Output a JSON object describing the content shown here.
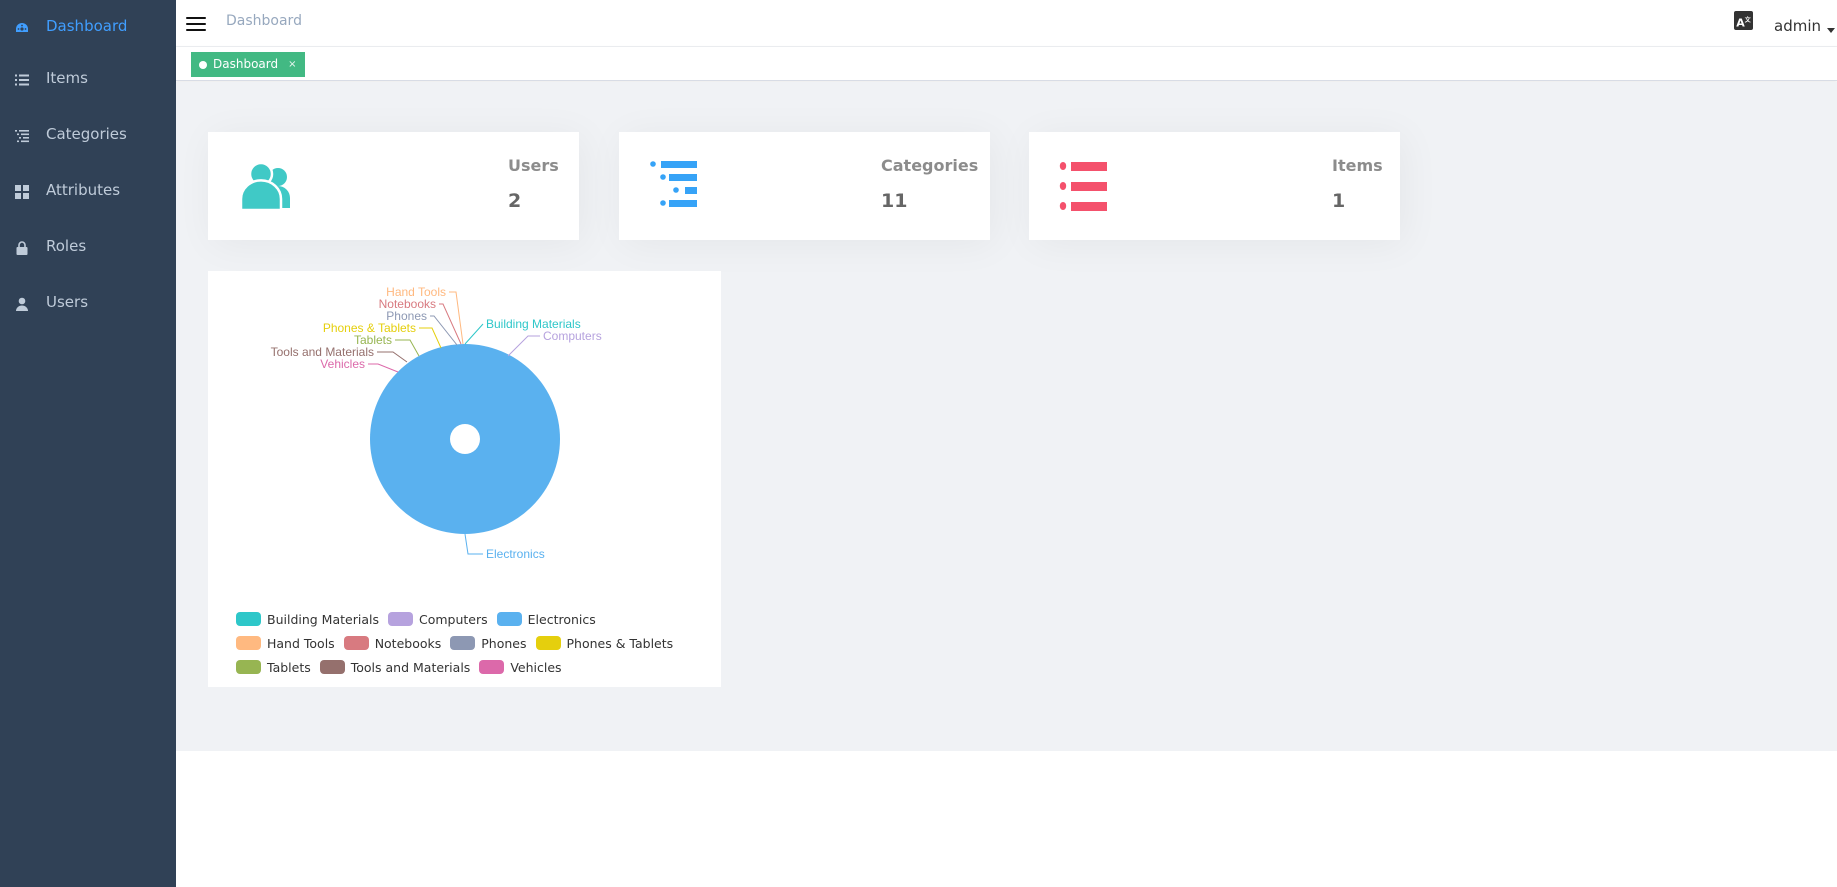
{
  "sidebar": {
    "items": [
      {
        "label": "Dashboard",
        "icon": "dashboard-icon",
        "active": true
      },
      {
        "label": "Items",
        "icon": "list-icon",
        "active": false
      },
      {
        "label": "Categories",
        "icon": "tree-list-icon",
        "active": false
      },
      {
        "label": "Attributes",
        "icon": "grid-icon",
        "active": false
      },
      {
        "label": "Roles",
        "icon": "lock-icon",
        "active": false
      },
      {
        "label": "Users",
        "icon": "user-icon",
        "active": false
      }
    ]
  },
  "navbar": {
    "breadcrumb": "Dashboard",
    "language_icon": "language-icon",
    "username": "admin"
  },
  "tags": [
    {
      "label": "Dashboard",
      "close": "×",
      "active": true
    }
  ],
  "cards": {
    "users": {
      "title": "Users",
      "value": "2",
      "color": "#40c9c6",
      "icon": "peoples-icon"
    },
    "categories": {
      "title": "Categories",
      "value": "11",
      "color": "#36a3f7",
      "icon": "tree-list-icon"
    },
    "items": {
      "title": "Items",
      "value": "1",
      "color": "#f4516c",
      "icon": "list-icon"
    }
  },
  "chart_data": {
    "type": "pie",
    "title": "",
    "categories": [
      "Building Materials",
      "Computers",
      "Electronics",
      "Hand Tools",
      "Notebooks",
      "Phones",
      "Phones & Tablets",
      "Tablets",
      "Tools and Materials",
      "Vehicles"
    ],
    "values": [
      0,
      0,
      1,
      0,
      0,
      0,
      0,
      0,
      0,
      0
    ],
    "colors": [
      "#2ec7c9",
      "#b6a2de",
      "#5ab1ef",
      "#ffb980",
      "#d87a80",
      "#8d98b3",
      "#e5cf0d",
      "#97b552",
      "#95706d",
      "#dc69aa"
    ],
    "legend_position": "bottom",
    "donut": true
  }
}
